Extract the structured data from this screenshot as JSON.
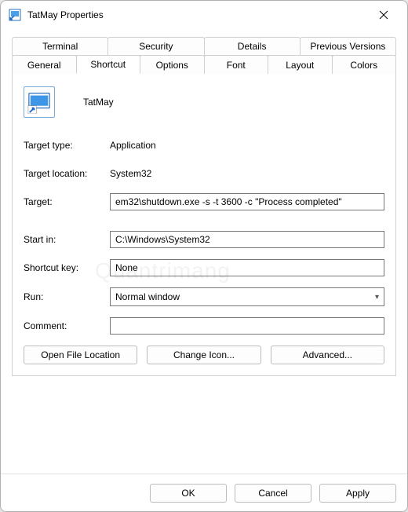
{
  "window": {
    "title": "TatMay Properties"
  },
  "tabs": {
    "row1": [
      "Terminal",
      "Security",
      "Details",
      "Previous Versions"
    ],
    "row2": [
      "General",
      "Shortcut",
      "Options",
      "Font",
      "Layout",
      "Colors"
    ],
    "active": "Shortcut"
  },
  "shortcut": {
    "name": "TatMay",
    "target_type_label": "Target type:",
    "target_type_value": "Application",
    "target_location_label": "Target location:",
    "target_location_value": "System32",
    "target_label": "Target:",
    "target_value": "em32\\shutdown.exe -s -t 3600 -c \"Process completed\"",
    "start_in_label": "Start in:",
    "start_in_value": "C:\\Windows\\System32",
    "shortcut_key_label": "Shortcut key:",
    "shortcut_key_value": "None",
    "run_label": "Run:",
    "run_value": "Normal window",
    "comment_label": "Comment:",
    "comment_value": ""
  },
  "buttons": {
    "open_file_location": "Open File Location",
    "change_icon": "Change Icon...",
    "advanced": "Advanced...",
    "ok": "OK",
    "cancel": "Cancel",
    "apply": "Apply"
  },
  "watermark": "Quantrimang"
}
